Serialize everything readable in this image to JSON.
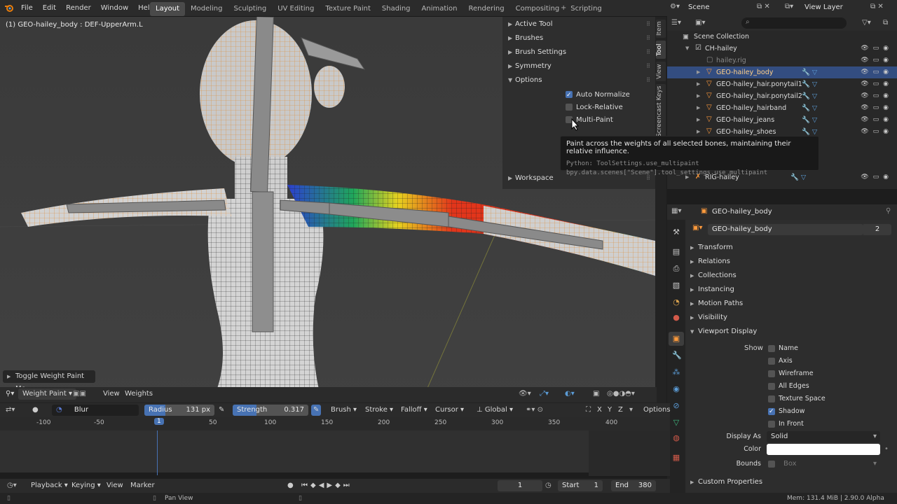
{
  "menu": [
    "File",
    "Edit",
    "Render",
    "Window",
    "Help"
  ],
  "workspaces": [
    "Layout",
    "Modeling",
    "Sculpting",
    "UV Editing",
    "Texture Paint",
    "Shading",
    "Animation",
    "Rendering",
    "Compositing",
    "Scripting"
  ],
  "active_workspace": "Layout",
  "scene": "Scene",
  "view_layer": "View Layer",
  "viewport": {
    "header_label": "(1) GEO-hailey_body : DEF-UpperArm.L",
    "operator_panel": "Toggle Weight Paint Mo"
  },
  "npanel": {
    "sections": [
      "Active Tool",
      "Brushes",
      "Brush Settings",
      "Symmetry",
      "Options",
      "Workspace"
    ],
    "options": [
      {
        "label": "Auto Normalize",
        "checked": true
      },
      {
        "label": "Lock-Relative",
        "checked": false
      },
      {
        "label": "Multi-Paint",
        "checked": false
      }
    ],
    "tabs": [
      "Item",
      "Tool",
      "View",
      "Screencast Keys"
    ]
  },
  "tooltip": {
    "text": "Paint across the weights of all selected bones, maintaining their relative influence.",
    "python1": "Python: ToolSettings.use_multipaint",
    "python2": "bpy.data.scenes[\"Scene\"].tool_settings.use_multipaint"
  },
  "vp_header": {
    "mode": "Weight Paint",
    "view": "View",
    "weights": "Weights"
  },
  "tool_settings": {
    "brush": "Blur",
    "radius_label": "Radius",
    "radius_value": "131 px",
    "strength_label": "Strength",
    "strength_value": "0.317",
    "brush_menu": "Brush",
    "stroke_menu": "Stroke",
    "falloff_menu": "Falloff",
    "cursor_menu": "Cursor",
    "orientation": "Global",
    "axes": [
      "X",
      "Y",
      "Z"
    ],
    "options": "Options"
  },
  "timeline": {
    "ticks": [
      "-100",
      "-50",
      "1",
      "50",
      "100",
      "150",
      "200",
      "250",
      "300",
      "350",
      "400"
    ],
    "current_frame": "1",
    "playback": "Playback",
    "keying": "Keying",
    "view": "View",
    "marker": "Marker",
    "frame_field": "1",
    "start_label": "Start",
    "start": "1",
    "end_label": "End",
    "end": "380"
  },
  "status": {
    "center": "Pan View",
    "memory": "Mem: 131.4 MiB | 2.90.0 Alpha"
  },
  "outliner": {
    "root": "Scene Collection",
    "rows": [
      {
        "label": "CH-hailey",
        "indent": 1
      },
      {
        "label": "hailey.rig",
        "indent": 2
      },
      {
        "label": "GEO-hailey_body",
        "indent": 2
      },
      {
        "label": "GEO-hailey_hair.ponytail1",
        "indent": 2
      },
      {
        "label": "GEO-hailey_hair.ponytail2",
        "indent": 2
      },
      {
        "label": "GEO-hailey_hairband",
        "indent": 2
      },
      {
        "label": "GEO-hailey_jeans",
        "indent": 2
      },
      {
        "label": "GEO-hailey_shoes",
        "indent": 2
      },
      {
        "label": "RIG-hailey",
        "indent": 1
      }
    ]
  },
  "properties": {
    "object": "GEO-hailey_body",
    "name_field": "GEO-hailey_body",
    "users": "2",
    "sections": [
      "Transform",
      "Relations",
      "Collections",
      "Instancing",
      "Motion Paths",
      "Visibility",
      "Viewport Display"
    ],
    "show_label": "Show",
    "show_options": [
      {
        "label": "Name",
        "checked": false
      },
      {
        "label": "Axis",
        "checked": false
      },
      {
        "label": "Wireframe",
        "checked": false
      },
      {
        "label": "All Edges",
        "checked": false
      },
      {
        "label": "Texture Space",
        "checked": false
      },
      {
        "label": "Shadow",
        "checked": true
      },
      {
        "label": "In Front",
        "checked": false
      }
    ],
    "display_as_label": "Display As",
    "display_as": "Solid",
    "color_label": "Color",
    "bounds_label": "Bounds",
    "bounds_value": "Box",
    "custom_properties": "Custom Properties"
  },
  "colors": {
    "accent": "#4772b3",
    "selection": "#334d80",
    "object_orange": "#ff9a3c"
  }
}
